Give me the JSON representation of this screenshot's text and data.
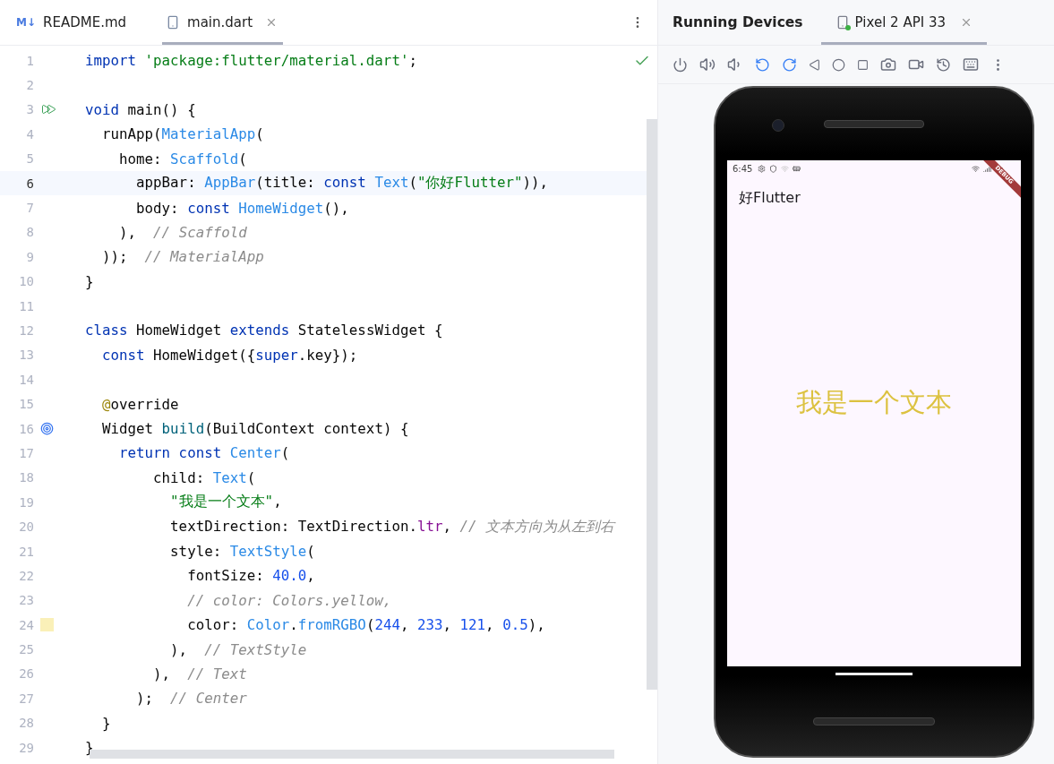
{
  "editor": {
    "tabs": [
      {
        "icon_text": "M↓",
        "label": "README.md",
        "selected": false,
        "closable": false
      },
      {
        "label": "main.dart",
        "selected": true,
        "closable": true
      }
    ],
    "lines": [
      {
        "number": "1",
        "current": false,
        "tokens": [
          {
            "text": "import ",
            "kind": "kw"
          },
          {
            "text": "'package:flutter/material.dart'",
            "kind": "str"
          },
          {
            "text": ";",
            "kind": "plain"
          }
        ]
      },
      {
        "number": "2",
        "current": false
      },
      {
        "number": "3",
        "current": false,
        "gutter": {
          "kind": "run"
        },
        "tokens": [
          {
            "text": "void",
            "kind": "kw"
          },
          {
            "text": " main() {",
            "kind": "plain"
          }
        ]
      },
      {
        "number": "4",
        "current": false,
        "tokens": [
          {
            "text": "  runApp(",
            "kind": "plain"
          },
          {
            "text": "MaterialApp",
            "kind": "type"
          },
          {
            "text": "(",
            "kind": "plain"
          }
        ]
      },
      {
        "number": "5",
        "current": false,
        "tokens": [
          {
            "text": "    home: ",
            "kind": "plain"
          },
          {
            "text": "Scaffold",
            "kind": "type"
          },
          {
            "text": "(",
            "kind": "plain"
          }
        ]
      },
      {
        "number": "6",
        "current": true,
        "tokens": [
          {
            "text": "      appBar: ",
            "kind": "plain"
          },
          {
            "text": "AppBar",
            "kind": "type"
          },
          {
            "text": "(title: ",
            "kind": "plain"
          },
          {
            "text": "const ",
            "kind": "kw"
          },
          {
            "text": "Text",
            "kind": "type"
          },
          {
            "text": "(",
            "kind": "plain"
          },
          {
            "text": "\"你好Flutter\"",
            "kind": "str"
          },
          {
            "text": ")),",
            "kind": "plain"
          }
        ]
      },
      {
        "number": "7",
        "current": false,
        "tokens": [
          {
            "text": "      body: ",
            "kind": "plain"
          },
          {
            "text": "const ",
            "kind": "kw"
          },
          {
            "text": "HomeWidget",
            "kind": "type"
          },
          {
            "text": "(),",
            "kind": "plain"
          }
        ]
      },
      {
        "number": "8",
        "current": false,
        "tokens": [
          {
            "text": "    ),  ",
            "kind": "plain"
          },
          {
            "text": "// Scaffold",
            "kind": "comment"
          }
        ]
      },
      {
        "number": "9",
        "current": false,
        "tokens": [
          {
            "text": "  ));  ",
            "kind": "plain"
          },
          {
            "text": "// MaterialApp",
            "kind": "comment"
          }
        ]
      },
      {
        "number": "10",
        "current": false,
        "tokens": [
          {
            "text": "}",
            "kind": "plain"
          }
        ]
      },
      {
        "number": "11",
        "current": false
      },
      {
        "number": "12",
        "current": false,
        "tokens": [
          {
            "text": "class",
            "kind": "kw"
          },
          {
            "text": " HomeWidget ",
            "kind": "plain"
          },
          {
            "text": "extends",
            "kind": "kw"
          },
          {
            "text": " StatelessWidget {",
            "kind": "plain"
          }
        ]
      },
      {
        "number": "13",
        "current": false,
        "tokens": [
          {
            "text": "  const",
            "kind": "kw"
          },
          {
            "text": " HomeWidget({",
            "kind": "plain"
          },
          {
            "text": "super",
            "kind": "kw"
          },
          {
            "text": ".key});",
            "kind": "plain"
          }
        ]
      },
      {
        "number": "14",
        "current": false
      },
      {
        "number": "15",
        "current": false,
        "tokens": [
          {
            "text": "  @",
            "kind": "annot"
          },
          {
            "text": "override",
            "kind": "plain"
          }
        ]
      },
      {
        "number": "16",
        "current": false,
        "gutter": {
          "kind": "override"
        },
        "tokens": [
          {
            "text": "  Widget ",
            "kind": "plain"
          },
          {
            "text": "build",
            "kind": "func"
          },
          {
            "text": "(BuildContext context) {",
            "kind": "plain"
          }
        ]
      },
      {
        "number": "17",
        "current": false,
        "tokens": [
          {
            "text": "    return const ",
            "kind": "kw"
          },
          {
            "text": "Center",
            "kind": "type"
          },
          {
            "text": "(",
            "kind": "plain"
          }
        ]
      },
      {
        "number": "18",
        "current": false,
        "tokens": [
          {
            "text": "        child: ",
            "kind": "plain"
          },
          {
            "text": "Text",
            "kind": "type"
          },
          {
            "text": "(",
            "kind": "plain"
          }
        ]
      },
      {
        "number": "19",
        "current": false,
        "tokens": [
          {
            "text": "          \"我是一个文本\"",
            "kind": "str"
          },
          {
            "text": ",",
            "kind": "plain"
          }
        ]
      },
      {
        "number": "20",
        "current": false,
        "tokens": [
          {
            "text": "          textDirection: TextDirection.",
            "kind": "plain"
          },
          {
            "text": "ltr",
            "kind": "field"
          },
          {
            "text": ", ",
            "kind": "plain"
          },
          {
            "text": "// 文本方向为从左到右",
            "kind": "comment"
          }
        ]
      },
      {
        "number": "21",
        "current": false,
        "tokens": [
          {
            "text": "          style: ",
            "kind": "plain"
          },
          {
            "text": "TextStyle",
            "kind": "type"
          },
          {
            "text": "(",
            "kind": "plain"
          }
        ]
      },
      {
        "number": "22",
        "current": false,
        "tokens": [
          {
            "text": "            fontSize: ",
            "kind": "plain"
          },
          {
            "text": "40.0",
            "kind": "num"
          },
          {
            "text": ",",
            "kind": "plain"
          }
        ]
      },
      {
        "number": "23",
        "current": false,
        "tokens": [
          {
            "text": "            // color: Colors.yellow,",
            "kind": "comment"
          }
        ]
      },
      {
        "number": "24",
        "current": false,
        "gutter": {
          "kind": "swatch"
        },
        "tokens": [
          {
            "text": "            color: ",
            "kind": "plain"
          },
          {
            "text": "Color",
            "kind": "type"
          },
          {
            "text": ".",
            "kind": "plain"
          },
          {
            "text": "fromRGBO",
            "kind": "type"
          },
          {
            "text": "(",
            "kind": "plain"
          },
          {
            "text": "244",
            "kind": "num"
          },
          {
            "text": ", ",
            "kind": "plain"
          },
          {
            "text": "233",
            "kind": "num"
          },
          {
            "text": ", ",
            "kind": "plain"
          },
          {
            "text": "121",
            "kind": "num"
          },
          {
            "text": ", ",
            "kind": "plain"
          },
          {
            "text": "0.5",
            "kind": "num"
          },
          {
            "text": "),",
            "kind": "plain"
          }
        ]
      },
      {
        "number": "25",
        "current": false,
        "tokens": [
          {
            "text": "          ),  ",
            "kind": "plain"
          },
          {
            "text": "// TextStyle",
            "kind": "comment"
          }
        ]
      },
      {
        "number": "26",
        "current": false,
        "tokens": [
          {
            "text": "        ),  ",
            "kind": "plain"
          },
          {
            "text": "// Text",
            "kind": "comment"
          }
        ]
      },
      {
        "number": "27",
        "current": false,
        "tokens": [
          {
            "text": "      );  ",
            "kind": "plain"
          },
          {
            "text": "// Center",
            "kind": "comment"
          }
        ]
      },
      {
        "number": "28",
        "current": false,
        "tokens": [
          {
            "text": "  }",
            "kind": "plain"
          }
        ]
      },
      {
        "number": "29",
        "current": false,
        "tokens": [
          {
            "text": "}",
            "kind": "plain"
          }
        ]
      }
    ]
  },
  "devices": {
    "title": "Running Devices",
    "tabs": [
      {
        "label": "Pixel 2 API 33",
        "selected": true
      }
    ],
    "phone": {
      "time": "6:45",
      "banner": "DEBUG",
      "app_title": "好Flutter",
      "center_text": "我是一个文本"
    }
  }
}
